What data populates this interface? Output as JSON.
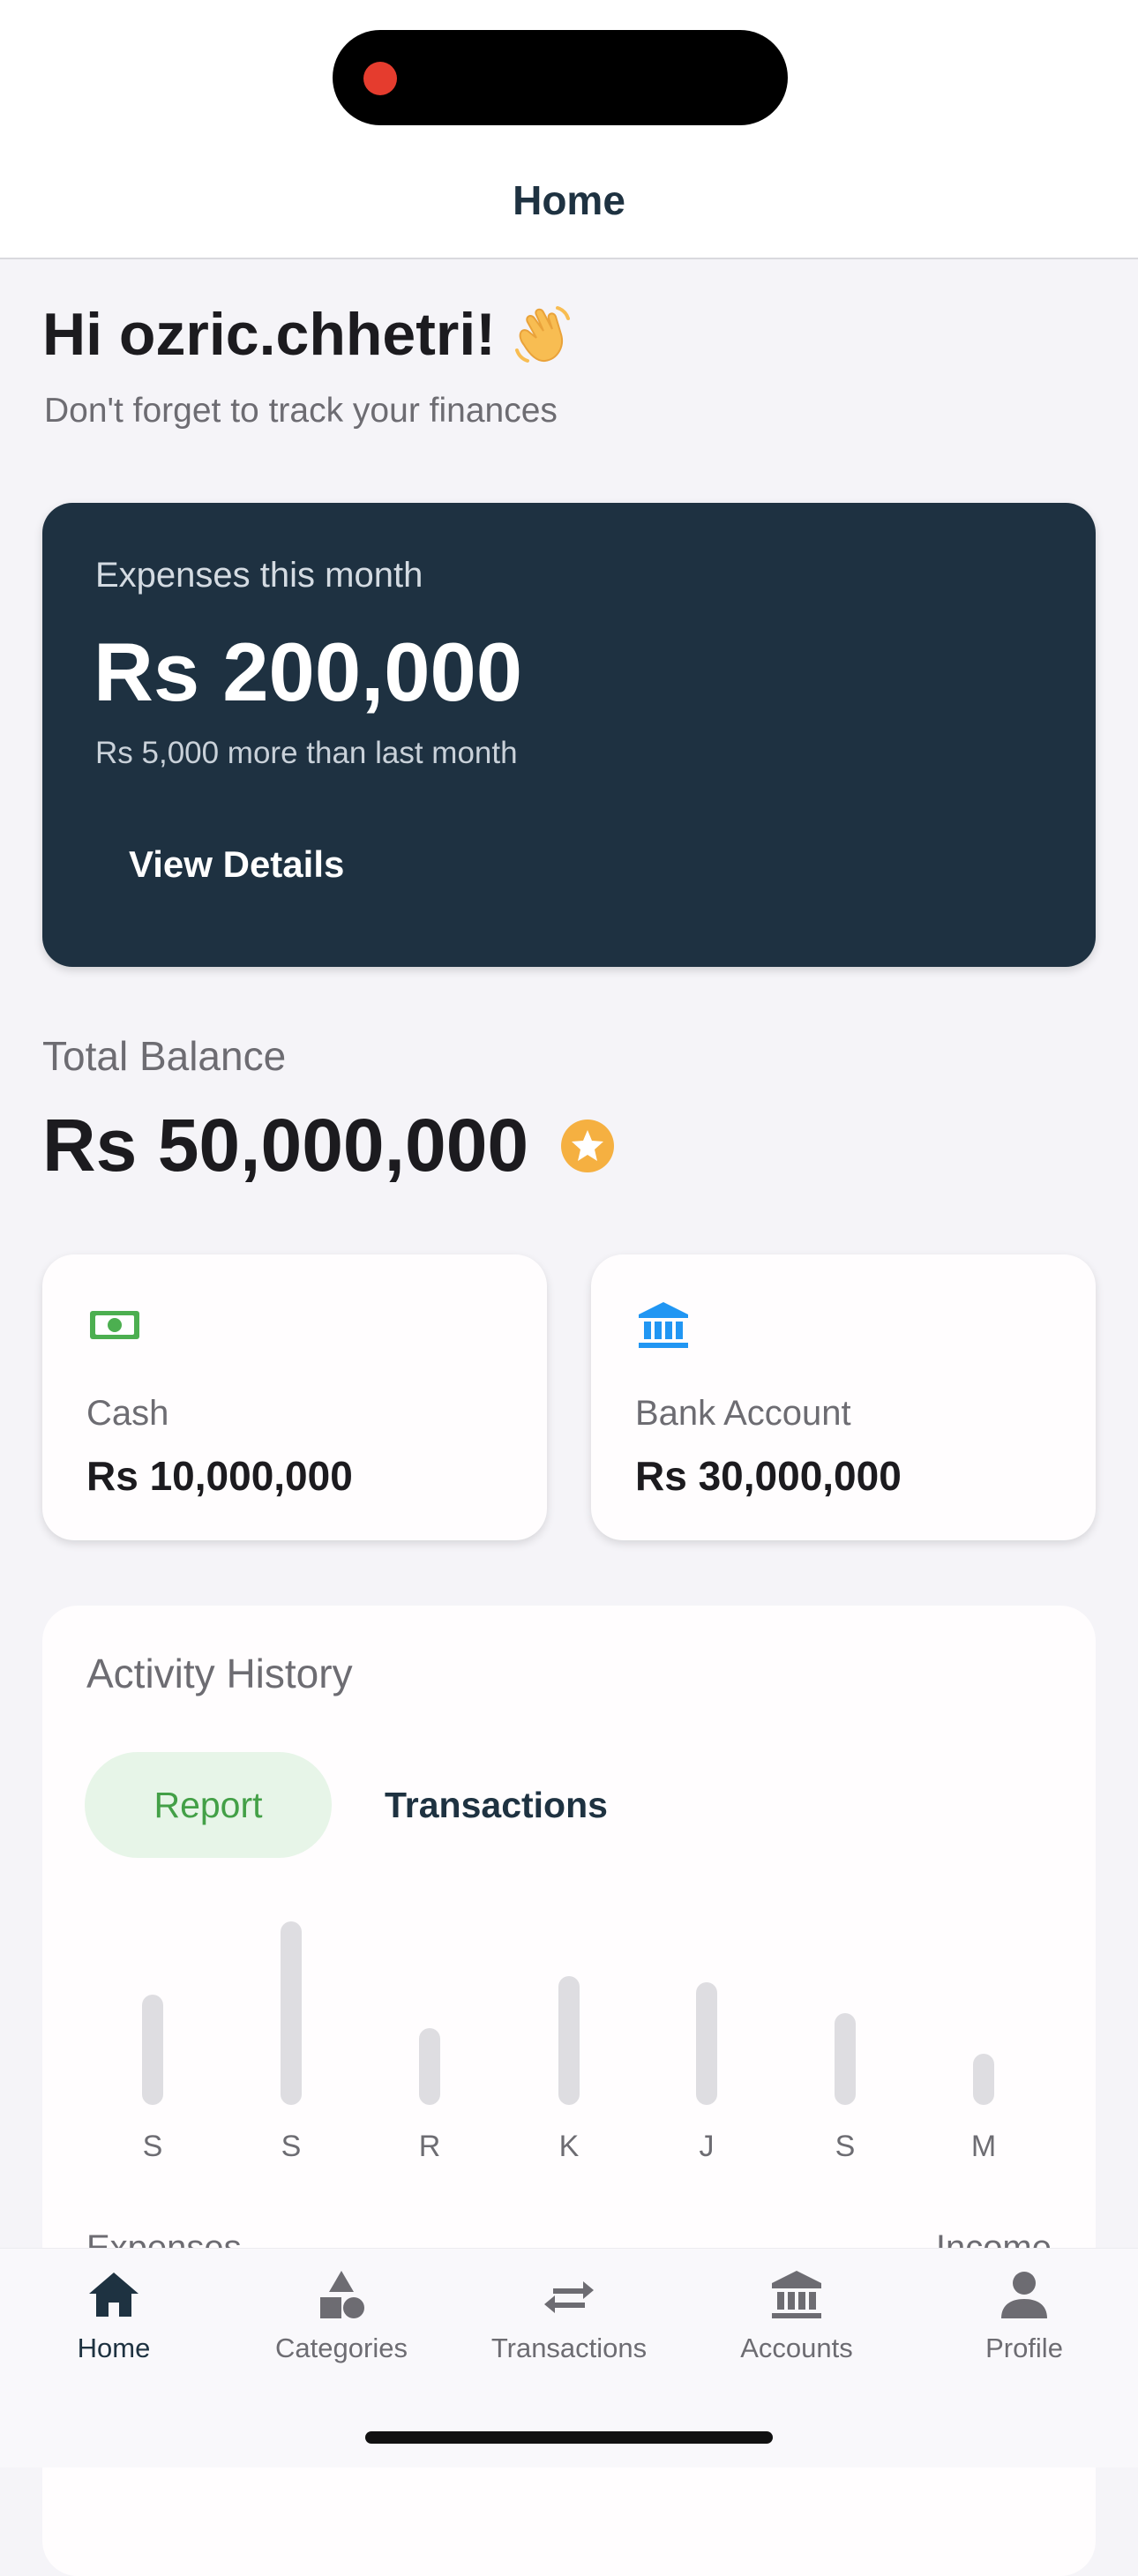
{
  "header": {
    "title": "Home"
  },
  "greeting": {
    "title": "Hi ozric.chhetri!",
    "subtitle": "Don't forget to track your finances",
    "icon": "waving-hand-icon"
  },
  "expenses_card": {
    "label": "Expenses this month",
    "amount": "Rs 200,000",
    "comparison": "Rs 5,000 more than last month",
    "button_label": "View Details",
    "background_color": "#1e3141"
  },
  "balance": {
    "label": "Total Balance",
    "amount": "Rs 50,000,000",
    "icon": "star-badge-icon"
  },
  "accounts": [
    {
      "icon": "cash-icon",
      "label": "Cash",
      "amount": "Rs 10,000,000",
      "icon_color": "#4caf50"
    },
    {
      "icon": "bank-icon",
      "label": "Bank Account",
      "amount": "Rs 30,000,000",
      "icon_color": "#2196f3"
    }
  ],
  "activity": {
    "title": "Activity History",
    "tabs": [
      {
        "label": "Report",
        "selected": true
      },
      {
        "label": "Transactions",
        "selected": false
      }
    ],
    "chart_data": {
      "type": "bar",
      "categories": [
        "S",
        "S",
        "R",
        "K",
        "J",
        "S",
        "M"
      ],
      "values": [
        0.6,
        1.0,
        0.42,
        0.7,
        0.67,
        0.5,
        0.28
      ],
      "grid": false
    },
    "footer_left": "Expenses",
    "footer_right": "Income"
  },
  "bottom_nav": [
    {
      "label": "Home",
      "icon": "home-icon",
      "active": true
    },
    {
      "label": "Categories",
      "icon": "categories-icon",
      "active": false
    },
    {
      "label": "Transactions",
      "icon": "transfer-arrows-icon",
      "active": false
    },
    {
      "label": "Accounts",
      "icon": "bank-icon",
      "active": false
    },
    {
      "label": "Profile",
      "icon": "person-icon",
      "active": false
    }
  ],
  "colors": {
    "accent_green": "#43a047",
    "star": "#f5b041",
    "nav_active": "#1e3241"
  }
}
